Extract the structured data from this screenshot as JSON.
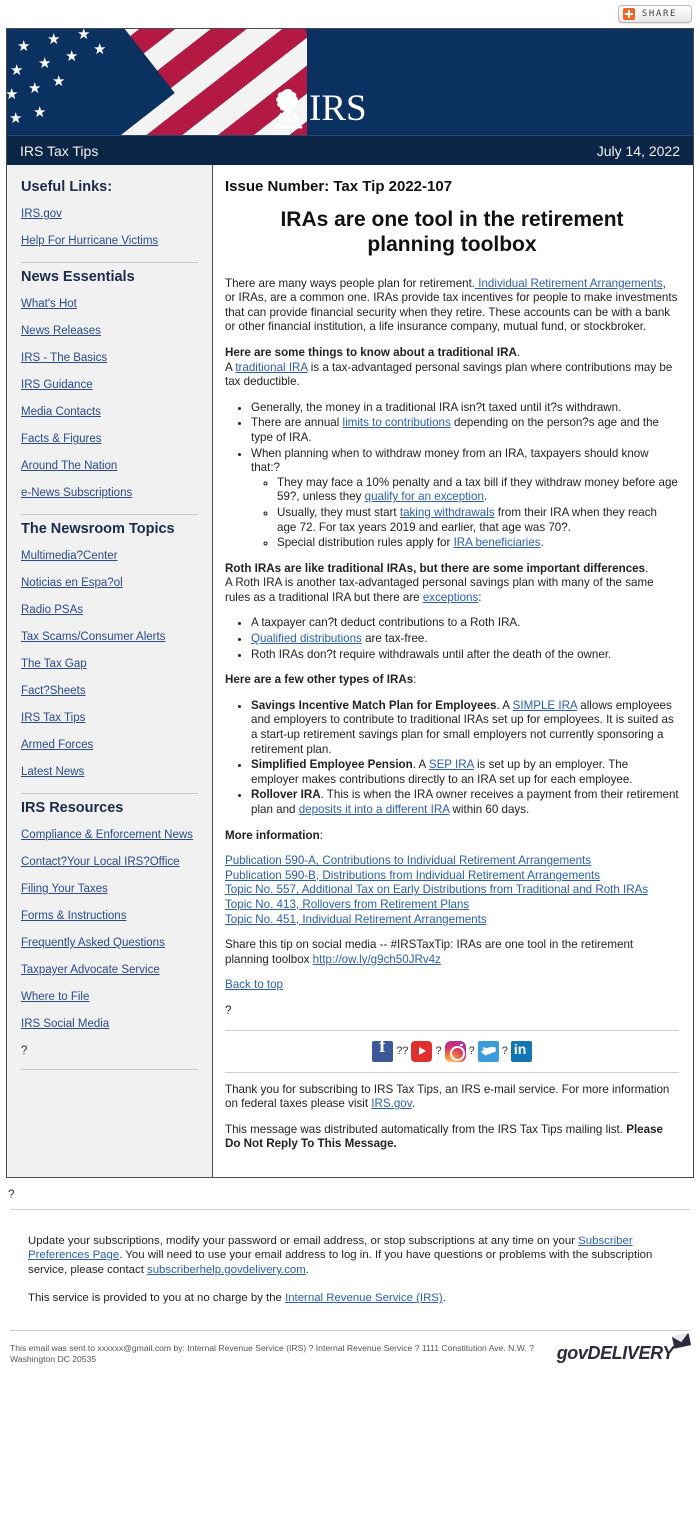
{
  "share": {
    "label": "SHARE",
    "icon": "plus-icon"
  },
  "banner": {
    "logo_text": "IRS",
    "seal_alt": "irs-eagle-seal"
  },
  "titlestrip": {
    "title": "IRS Tax Tips",
    "date": "July 14, 2022"
  },
  "sidebar": {
    "sections": [
      {
        "heading": "Useful Links:",
        "links": [
          "IRS.gov",
          "Help For Hurricane Victims"
        ]
      },
      {
        "heading": "News Essentials",
        "links": [
          "What's Hot",
          "News Releases",
          "IRS - The Basics",
          "IRS Guidance",
          "Media Contacts",
          "Facts & Figures",
          "Around The Nation",
          "e-News Subscriptions"
        ]
      },
      {
        "heading": "The Newsroom Topics",
        "links": [
          "Multimedia?Center",
          "Noticias en Espa?ol",
          "Radio PSAs",
          "Tax Scams/Consumer Alerts",
          "The Tax Gap",
          "Fact?Sheets",
          "IRS Tax Tips",
          "Armed Forces",
          "Latest News"
        ]
      },
      {
        "heading": "IRS Resources",
        "links": [
          "Compliance & Enforcement News",
          "Contact?Your Local IRS?Office",
          "Filing Your Taxes",
          "Forms & Instructions",
          "Frequently Asked Questions",
          "Taxpayer Advocate Service",
          "Where to File",
          "IRS Social Media"
        ],
        "trailing_text": "?"
      }
    ]
  },
  "main": {
    "issue_number": "Issue Number: Tax Tip 2022-107",
    "headline": "IRAs are one tool in the retirement planning toolbox",
    "intro": {
      "before_link": "There are many ways people plan for retirement.",
      "link": " Individual Retirement Arrangements",
      "after_link": ", or IRAs, are a common one. IRAs provide tax incentives for people to make investments that can provide financial security when they retire. These accounts can be with a bank or other financial institution, a life insurance company, mutual fund, or stockbroker."
    },
    "trad_heading": "Here are some things to know about a traditional IRA",
    "trad_heading_tail": ".",
    "trad_lead_before": "A ",
    "trad_lead_link": "traditional IRA",
    "trad_lead_after": " is a tax-advantaged personal savings plan where contributions may be tax deductible.",
    "trad_bullets": [
      {
        "text": "Generally, the money in a traditional IRA isn?t taxed until it?s withdrawn."
      },
      {
        "before": "There are annual ",
        "link": "limits to contributions",
        "after": " depending on the person?s age and the type of IRA."
      },
      {
        "text": "When planning when to withdraw money from an IRA, taxpayers should know that:?",
        "sub": [
          {
            "before": "They may face a 10% penalty and a tax bill if they withdraw money before age 59?, unless they ",
            "link": "qualify for an exception",
            "after": "."
          },
          {
            "before": "Usually, they must start ",
            "link": "taking withdrawals",
            "after": " from their IRA when they reach age 72. For tax years 2019 and earlier, that age was 70?."
          },
          {
            "before": "Special distribution rules apply for ",
            "link": "IRA beneficiaries",
            "after": "."
          }
        ]
      }
    ],
    "roth_heading": "Roth IRAs are like traditional IRAs, but there are some important differences",
    "roth_heading_tail": ".",
    "roth_lead_before": "A Roth IRA is another tax-advantaged personal savings plan with many of the same rules as a traditional IRA but there are ",
    "roth_lead_link": "exceptions",
    "roth_lead_after": ":",
    "roth_bullets": [
      {
        "text": "A taxpayer can?t deduct contributions to a Roth IRA."
      },
      {
        "before": "",
        "link": "Qualified distributions",
        "after": " are tax-free."
      },
      {
        "text": "Roth IRAs don?t require withdrawals until after the death of the owner."
      }
    ],
    "other_heading": "Here are a few other types of IRAs",
    "other_heading_tail": ":",
    "other_bullets": [
      {
        "bold": "Savings Incentive Match Plan for Employees",
        "before": ". A ",
        "link": "SIMPLE IRA",
        "after": " allows employees and employers to contribute to traditional IRAs set up for employees. It is suited as a start-up retirement savings plan for small employers not currently sponsoring a retirement plan."
      },
      {
        "bold": "Simplified Employee Pension",
        "before": ". A ",
        "link": "SEP IRA",
        "after": " is set up by an employer. The employer makes contributions directly to an IRA set up for each employee."
      },
      {
        "bold": "Rollover IRA",
        "before": ". This is when the IRA owner receives a payment from their retirement plan and ",
        "link": "deposits it into a different IRA",
        "after": " within 60 days."
      }
    ],
    "more_info_heading": "More information",
    "more_info_heading_tail": ":",
    "more_info_links": [
      "Publication 590-A, Contributions to Individual Retirement Arrangements",
      "Publication 590-B, Distributions from Individual Retirement Arrangements",
      "Topic No. 557, Additional Tax on Early Distributions from Traditional and Roth IRAs",
      "Topic No. 413, Rollovers from Retirement Plans",
      "Topic No. 451, Individual Retirement Arrangements"
    ],
    "share_social_before": "Share this tip on social media -- #IRSTaxTip: IRAs are one tool in the retirement planning toolbox ",
    "share_social_link": "http://ow.ly/g9ch50JRv4z",
    "back_to_top": "Back to top",
    "stray_q": "?",
    "social_icons": [
      {
        "name": "facebook-icon",
        "sep": "??"
      },
      {
        "name": "youtube-icon",
        "sep": "?"
      },
      {
        "name": "instagram-icon",
        "sep": "?"
      },
      {
        "name": "twitter-icon",
        "sep": "?"
      },
      {
        "name": "linkedin-icon",
        "sep": ""
      }
    ],
    "thanks_before": "Thank you for subscribing to IRS Tax Tips, an IRS e-mail service. For more information on federal taxes please visit ",
    "thanks_link": "IRS.gov",
    "thanks_after": ".",
    "distributed_before": "This message was distributed automatically from the IRS Tax Tips mailing list. ",
    "distributed_bold": "Please Do Not Reply To This Message."
  },
  "footer": {
    "stray_q": "?",
    "update_before": "Update your subscriptions, modify your password or email address, or stop subscriptions at any time on your ",
    "update_link1": "Subscriber Preferences Page",
    "update_mid": ". You will need to use your email address to log in. If you have questions or problems with the subscription service, please contact ",
    "update_link2": "subscriberhelp.govdelivery.com",
    "update_after": ".",
    "service_before": "This service is provided to you at no charge by the ",
    "service_link": "Internal Revenue Service (IRS)",
    "service_after": ".",
    "legal_text": "This email was sent to xxxxxx@gmail.com by: Internal Revenue Service (IRS) ? Internal Revenue Service ? 1111 Constitution Ave. N.W. ? Washington DC 20535",
    "govdelivery_word": "govDELIVERY"
  },
  "colors": {
    "banner_blue": "#0b3160",
    "strip_blue": "#0a2545",
    "flag_red": "#b31942",
    "link_blue": "#2a5faa",
    "sidebar_link": "#2a4b8d",
    "sidebar_bg": "#f1f1f1",
    "accent_orange": "#f26522"
  }
}
